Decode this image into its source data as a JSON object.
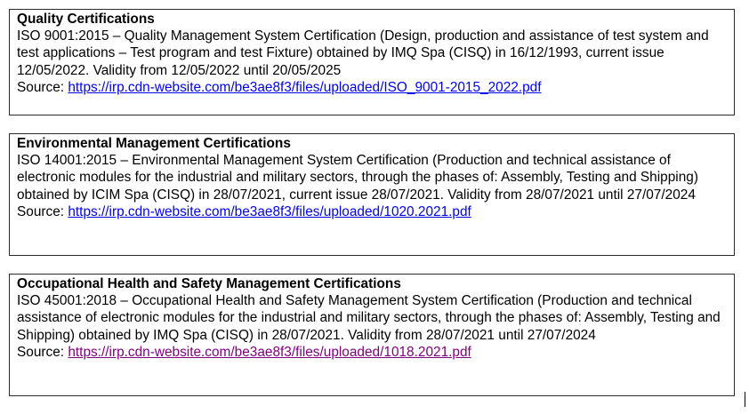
{
  "certifications": [
    {
      "title": "Quality Certifications",
      "body": "ISO 9001:2015 – Quality Management System Certification (Design, production and assistance of test system and test applications – Test program and test Fixture) obtained by IMQ Spa (CISQ) in 16/12/1993, current issue 12/05/2022. Validity from 12/05/2022 until 20/05/2025",
      "source_label": "Source: ",
      "source_link": "https://irp.cdn-website.com/be3ae8f3/files/uploaded/ISO_9001-2015_2022.pdf"
    },
    {
      "title": "Environmental Management Certifications",
      "body": "ISO 14001:2015 – Environmental Management System Certification (Production and technical assistance of electronic modules for the industrial and military sectors, through the phases of: Assembly, Testing and Shipping) obtained by ICIM Spa (CISQ) in 28/07/2021, current issue 28/07/2021. Validity from 28/07/2021 until 27/07/2024",
      "source_label": "Source: ",
      "source_link": "https://irp.cdn-website.com/be3ae8f3/files/uploaded/1020.2021.pdf"
    },
    {
      "title": "Occupational Health and Safety Management Certifications",
      "body": "ISO 45001:2018 – Occupational Health and Safety Management System Certification (Production and technical assistance of electronic modules for the industrial and military sectors, through the phases of: Assembly, Testing and Shipping) obtained by IMQ Spa (CISQ) in 28/07/2021. Validity from 28/07/2021 until 27/07/2024",
      "source_label": "Source: ",
      "source_link": "https://irp.cdn-website.com/be3ae8f3/files/uploaded/1018.2021.pdf"
    }
  ],
  "colors": {
    "link": "#0000ee",
    "link_visited": "#800080",
    "border": "#2b2b2b"
  }
}
